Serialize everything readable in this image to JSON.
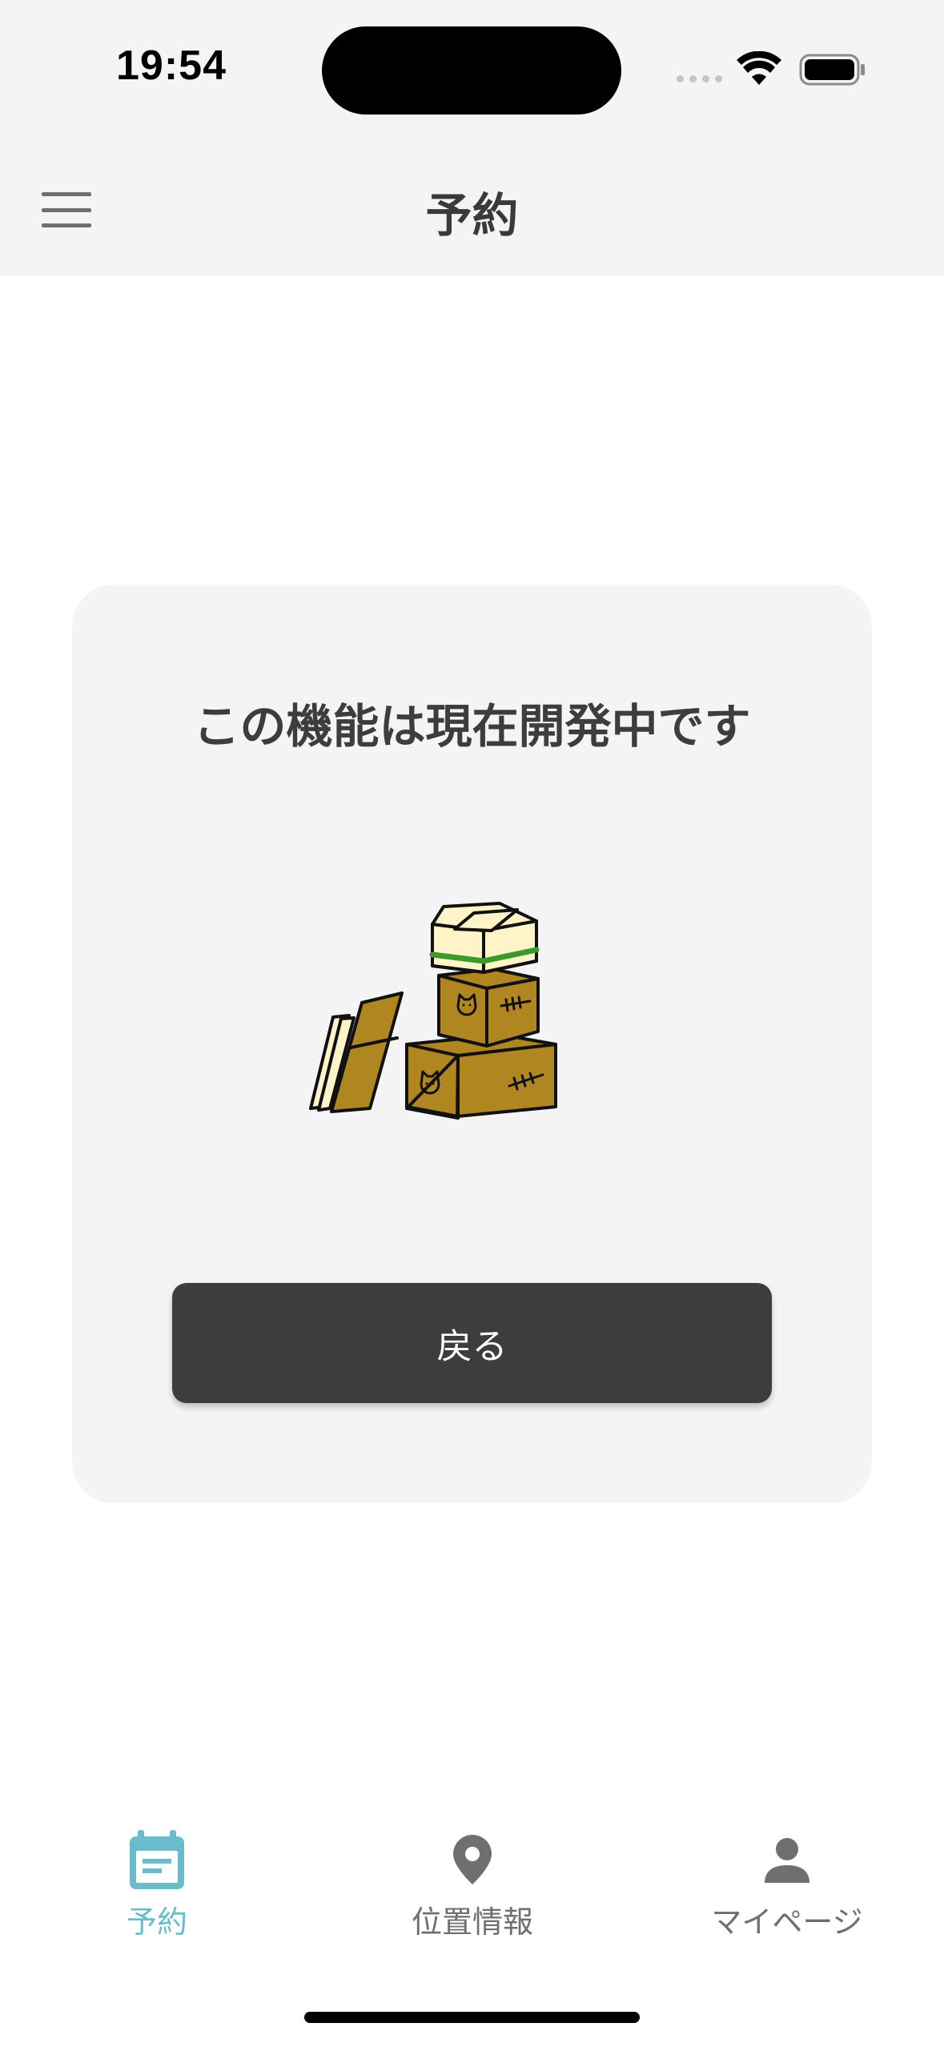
{
  "status_bar": {
    "time": "19:54"
  },
  "header": {
    "title": "予約",
    "menu_icon": "hamburger-menu-icon"
  },
  "card": {
    "message": "この機能は現在開発中です",
    "illustration": "cardboard-boxes-illustration",
    "back_button_label": "戻る"
  },
  "bottom_nav": {
    "items": [
      {
        "label": "予約",
        "icon": "calendar-icon",
        "active": true
      },
      {
        "label": "位置情報",
        "icon": "location-pin-icon",
        "active": false
      },
      {
        "label": "マイページ",
        "icon": "person-icon",
        "active": false
      }
    ]
  },
  "colors": {
    "accent": "#6bbccb",
    "header_bg": "#f4f4f4",
    "card_bg": "#f4f4f4",
    "button_bg": "#3d3d3d",
    "box_brown": "#b08620",
    "box_cream": "#fff4c8"
  }
}
